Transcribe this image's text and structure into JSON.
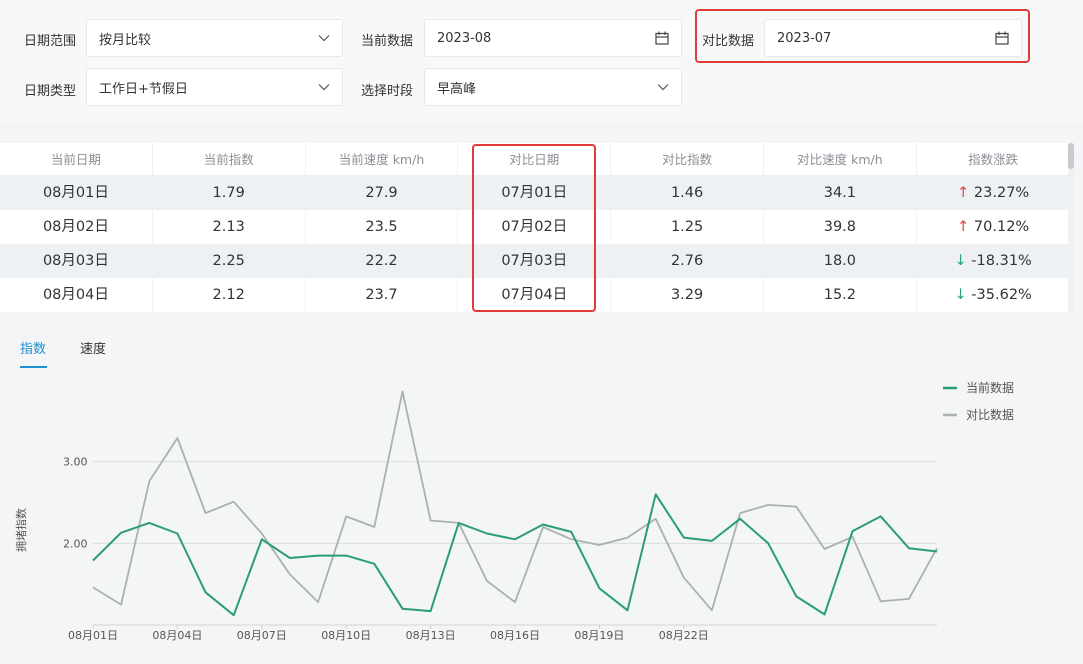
{
  "filters": {
    "date_range_label": "日期范围",
    "date_range_value": "按月比较",
    "current_data_label": "当前数据",
    "current_data_value": "2023-08",
    "compare_data_label": "对比数据",
    "compare_data_value": "2023-07",
    "date_type_label": "日期类型",
    "date_type_value": "工作日+节假日",
    "period_label": "选择时段",
    "period_value": "早高峰"
  },
  "table": {
    "headers": [
      "当前日期",
      "当前指数",
      "当前速度 km/h",
      "对比日期",
      "对比指数",
      "对比速度 km/h",
      "指数涨跌"
    ],
    "rows": [
      {
        "current_date": "08月01日",
        "current_index": "1.79",
        "current_speed": "27.9",
        "compare_date": "07月01日",
        "compare_index": "1.46",
        "compare_speed": "34.1",
        "change_arrow": "↑",
        "change": "23.27%"
      },
      {
        "current_date": "08月02日",
        "current_index": "2.13",
        "current_speed": "23.5",
        "compare_date": "07月02日",
        "compare_index": "1.25",
        "compare_speed": "39.8",
        "change_arrow": "↑",
        "change": "70.12%"
      },
      {
        "current_date": "08月03日",
        "current_index": "2.25",
        "current_speed": "22.2",
        "compare_date": "07月03日",
        "compare_index": "2.76",
        "compare_speed": "18.0",
        "change_arrow": "↓",
        "change": "-18.31%"
      },
      {
        "current_date": "08月04日",
        "current_index": "2.12",
        "current_speed": "23.7",
        "compare_date": "07月04日",
        "compare_index": "3.29",
        "compare_speed": "15.2",
        "change_arrow": "↓",
        "change": "-35.62%"
      }
    ]
  },
  "tabs": {
    "index": "指数",
    "speed": "速度"
  },
  "colors": {
    "accent": "#1f8fd0",
    "current_series": "#2a9d78",
    "compare_series": "#a8b3ae",
    "highlight": "#e03a3a",
    "up": "#e04242",
    "down": "#2aa27a"
  },
  "chart_data": {
    "type": "line",
    "ylabel": "拥堵指数",
    "yticks": [
      "2.00",
      "3.00"
    ],
    "ytick_values": [
      2.0,
      3.0
    ],
    "ylim": [
      1.0,
      4.0
    ],
    "x_tick_labels": [
      "08月01日",
      "08月04日",
      "08月07日",
      "08月10日",
      "08月13日",
      "08月16日",
      "08月19日",
      "08月22日"
    ],
    "x_tick_positions": [
      1,
      4,
      7,
      10,
      13,
      16,
      19,
      22
    ],
    "x_range": [
      1,
      31
    ],
    "legend_position": "top-right",
    "series": [
      {
        "name": "当前数据",
        "x": [
          1,
          2,
          3,
          4,
          5,
          6,
          7,
          8,
          9,
          10,
          11,
          12,
          13,
          14,
          15,
          16,
          17,
          18,
          19,
          20,
          21,
          22,
          23,
          24,
          25,
          26,
          27,
          28,
          29,
          30,
          31
        ],
        "values": [
          1.79,
          2.13,
          2.25,
          2.12,
          1.4,
          1.12,
          2.05,
          1.82,
          1.85,
          1.85,
          1.75,
          1.2,
          1.17,
          2.25,
          2.12,
          2.05,
          2.23,
          2.14,
          1.45,
          1.18,
          2.6,
          2.07,
          2.03,
          2.3,
          2.0,
          1.35,
          1.13,
          2.15,
          2.33,
          1.94,
          1.9
        ]
      },
      {
        "name": "对比数据",
        "x": [
          1,
          2,
          3,
          4,
          5,
          6,
          7,
          8,
          9,
          10,
          11,
          12,
          13,
          14,
          15,
          16,
          17,
          18,
          19,
          20,
          21,
          22,
          23,
          24,
          25,
          26,
          27,
          28,
          29,
          30,
          31
        ],
        "values": [
          1.46,
          1.25,
          2.76,
          3.29,
          2.37,
          2.51,
          2.12,
          1.62,
          1.28,
          2.33,
          2.2,
          3.86,
          2.28,
          2.25,
          1.54,
          1.28,
          2.2,
          2.05,
          1.98,
          2.07,
          2.3,
          1.58,
          1.18,
          2.37,
          2.47,
          2.45,
          1.93,
          2.08,
          1.29,
          1.32,
          1.94
        ]
      }
    ]
  }
}
